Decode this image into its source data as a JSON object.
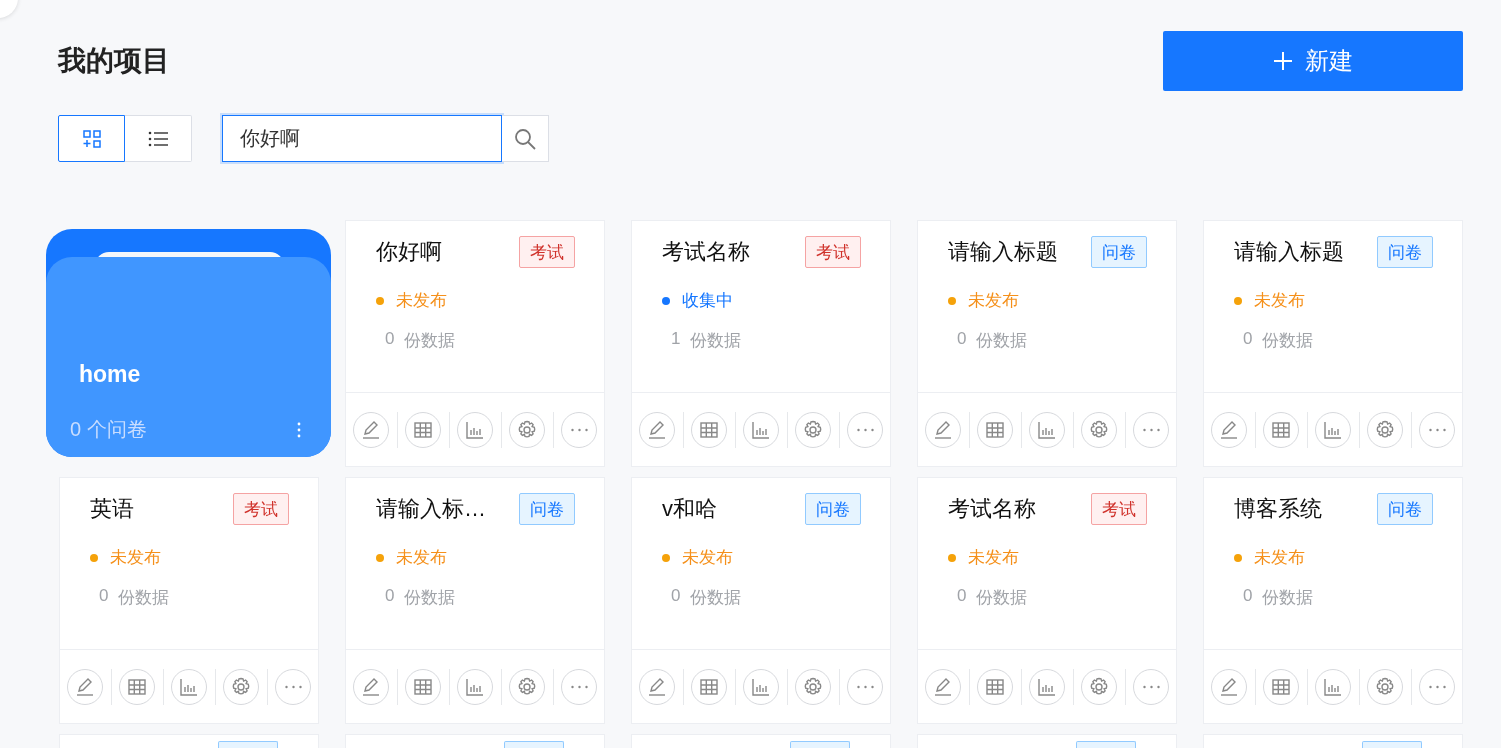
{
  "header": {
    "title": "我的项目",
    "new_button": {
      "label": "新建"
    }
  },
  "toolbar": {
    "views": [
      {
        "kind": "grid",
        "selected": true
      },
      {
        "kind": "list",
        "selected": false
      }
    ],
    "search": {
      "value": "你好啊"
    }
  },
  "folders": [
    {
      "name": "home",
      "count": "0 个问卷"
    }
  ],
  "projects": [
    {
      "title": "你好啊",
      "tag": {
        "label": "考试",
        "kind": "exam"
      },
      "status": {
        "label": "未发布",
        "kind": "draft"
      },
      "count": "0",
      "count_label": "份数据"
    },
    {
      "title": "考试名称",
      "tag": {
        "label": "考试",
        "kind": "exam"
      },
      "status": {
        "label": "收集中",
        "kind": "collecting"
      },
      "count": "1",
      "count_label": "份数据"
    },
    {
      "title": "请输入标题",
      "tag": {
        "label": "问卷",
        "kind": "survey"
      },
      "status": {
        "label": "未发布",
        "kind": "draft"
      },
      "count": "0",
      "count_label": "份数据"
    },
    {
      "title": "请输入标题",
      "tag": {
        "label": "问卷",
        "kind": "survey"
      },
      "status": {
        "label": "未发布",
        "kind": "draft"
      },
      "count": "0",
      "count_label": "份数据"
    },
    {
      "title": "英语",
      "tag": {
        "label": "考试",
        "kind": "exam"
      },
      "status": {
        "label": "未发布",
        "kind": "draft"
      },
      "count": "0",
      "count_label": "份数据"
    },
    {
      "title": "请输入标…",
      "tag": {
        "label": "问卷",
        "kind": "survey"
      },
      "status": {
        "label": "未发布",
        "kind": "draft"
      },
      "count": "0",
      "count_label": "份数据"
    },
    {
      "title": "v和哈",
      "tag": {
        "label": "问卷",
        "kind": "survey"
      },
      "status": {
        "label": "未发布",
        "kind": "draft"
      },
      "count": "0",
      "count_label": "份数据"
    },
    {
      "title": "考试名称",
      "tag": {
        "label": "考试",
        "kind": "exam"
      },
      "status": {
        "label": "未发布",
        "kind": "draft"
      },
      "count": "0",
      "count_label": "份数据"
    },
    {
      "title": "博客系统",
      "tag": {
        "label": "问卷",
        "kind": "survey"
      },
      "status": {
        "label": "未发布",
        "kind": "draft"
      },
      "count": "0",
      "count_label": "份数据"
    }
  ],
  "partial_cards": [
    {
      "tag": {
        "kind": "survey"
      }
    },
    {
      "tag": {
        "kind": "survey"
      }
    },
    {
      "tag": {
        "kind": "survey"
      }
    },
    {
      "tag": {
        "kind": "survey"
      }
    },
    {
      "tag": {
        "kind": "survey"
      }
    }
  ]
}
